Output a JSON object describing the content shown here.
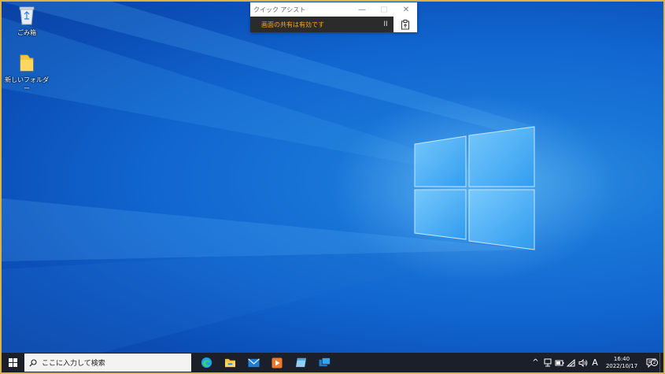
{
  "desktop": {
    "icons": [
      {
        "label": "ごみ箱",
        "icon": "recycle-bin-icon"
      },
      {
        "label": "新しいフォルダー",
        "icon": "folder-icon"
      }
    ]
  },
  "quick_assist": {
    "title": "クイック アシスト",
    "sharing_status": "画面の共有は有効です",
    "pause_glyph": "II",
    "minimize_glyph": "—",
    "maximize_glyph": "□",
    "close_glyph": "✕"
  },
  "taskbar": {
    "search_placeholder": "ここに入力して検索",
    "apps": [
      "edge-icon",
      "file-explorer-icon",
      "mail-icon",
      "media-player-icon",
      "notepad-icon",
      "quick-assist-app-icon"
    ],
    "tray": {
      "chevron_glyph": "^",
      "ime_mode": "A",
      "time": "16:40",
      "date": "2022/10/17",
      "notification_count": "2"
    }
  },
  "colors": {
    "frame_border": "#d8b24a",
    "share_text": "#f0a81e",
    "taskbar": "#1b1f2a"
  }
}
